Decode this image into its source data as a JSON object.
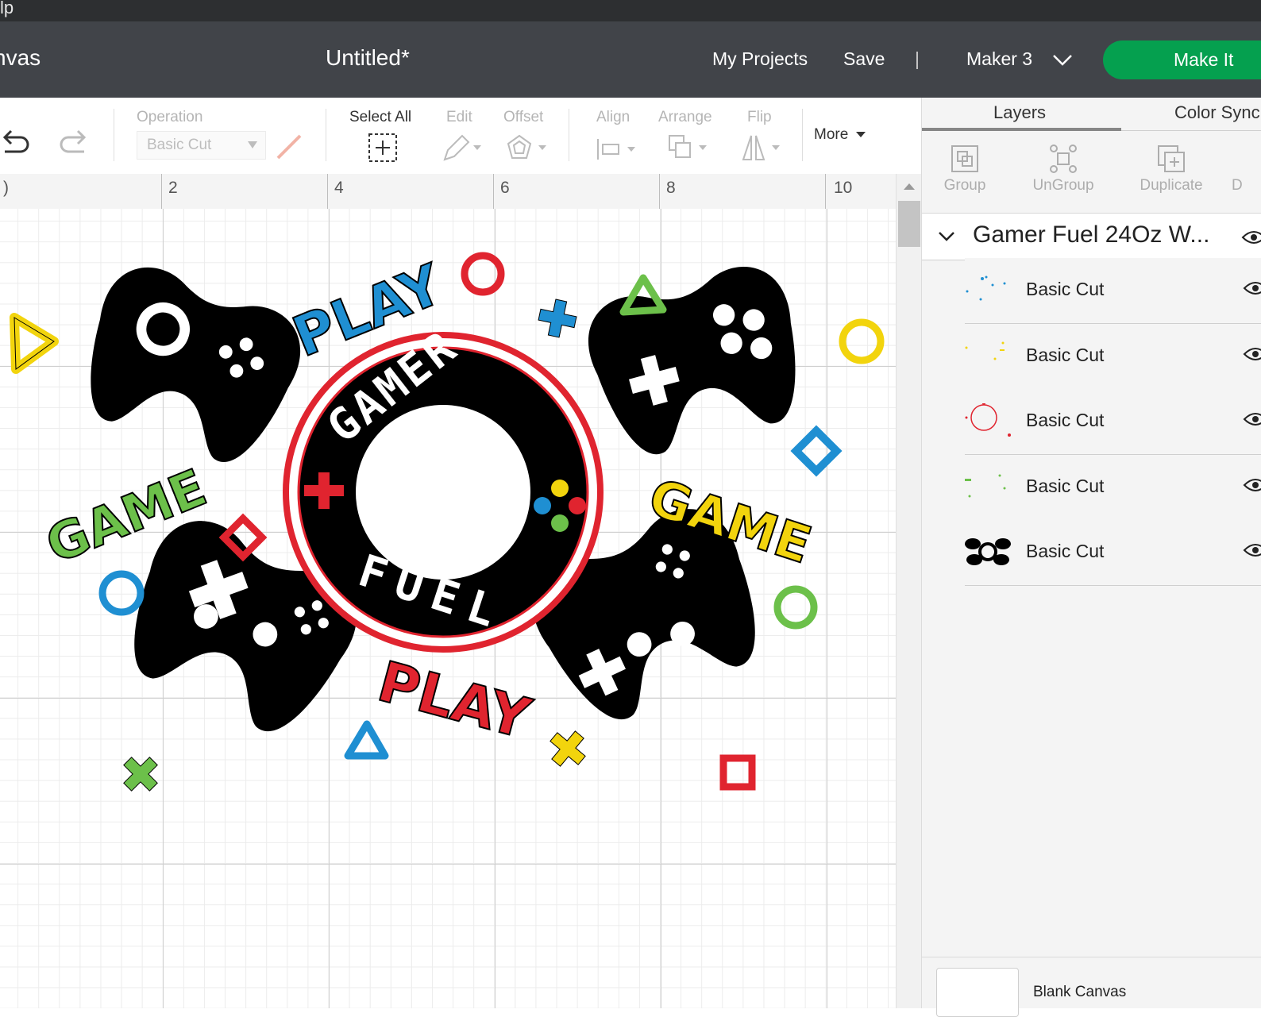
{
  "menu_strip": {
    "partial_label": "lp"
  },
  "header": {
    "app_name": "nvas",
    "doc_title": "Untitled*",
    "my_projects": "My Projects",
    "save": "Save",
    "separator": "|",
    "machine": "Maker 3",
    "make_it": "Make It"
  },
  "toolbar": {
    "operation_label": "Operation",
    "operation_value": "Basic Cut",
    "select_all": "Select All",
    "edit": "Edit",
    "offset": "Offset",
    "align": "Align",
    "arrange": "Arrange",
    "flip": "Flip",
    "more": "More"
  },
  "ruler": {
    "ticks": [
      ")",
      "2",
      "4",
      "6",
      "8",
      "10"
    ]
  },
  "canvas_art": {
    "texts": [
      "PLAY",
      "GAME",
      "GAMER",
      "FUEL",
      "GAME",
      "PLAY"
    ],
    "colors": {
      "black": "#000000",
      "red": "#e0242f",
      "blue": "#1f8fd2",
      "green": "#6cc04a",
      "yellow": "#f2d40d"
    }
  },
  "panel": {
    "tabs": [
      "Layers",
      "Color Sync"
    ],
    "actions": [
      "Group",
      "UnGroup",
      "Duplicate",
      "D"
    ],
    "group_name": "Gamer Fuel 24Oz W...",
    "layers": [
      {
        "name": "Basic Cut",
        "color": "#1f8fd2"
      },
      {
        "name": "Basic Cut",
        "color": "#f2d40d"
      },
      {
        "name": "Basic Cut",
        "color": "#e0242f"
      },
      {
        "name": "Basic Cut",
        "color": "#6cc04a"
      },
      {
        "name": "Basic Cut",
        "color": "#000000"
      }
    ],
    "blank_canvas": "Blank Canvas"
  },
  "accent": "#05a04f"
}
